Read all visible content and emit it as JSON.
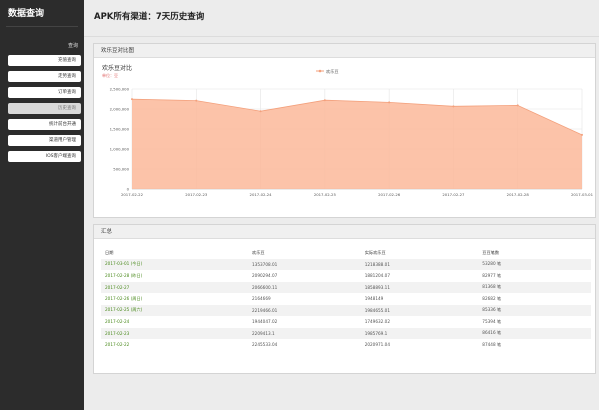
{
  "app": {
    "brand": "数据查询"
  },
  "sidebar": {
    "section_label": "查询",
    "items": [
      {
        "label": "充值查询",
        "active": false
      },
      {
        "label": "走势查询",
        "active": false
      },
      {
        "label": "订单查询",
        "active": false
      },
      {
        "label": "历史查询",
        "active": true
      },
      {
        "label": "统计前台开通",
        "active": false
      },
      {
        "label": "渠道用户管理",
        "active": false
      },
      {
        "label": "IOS客户端查询",
        "active": false
      }
    ]
  },
  "page": {
    "title": "APK所有渠道：7天历史查询"
  },
  "chart_panel": {
    "heading": "欢乐豆对比图"
  },
  "chart_data": {
    "type": "area",
    "title": "欢乐豆对比",
    "subtitle": "单位：豆",
    "x": [
      "2017-02-22",
      "2017-02-23",
      "2017-02-24",
      "2017-02-25",
      "2017-02-26",
      "2017-02-27",
      "2017-02-28",
      "2017-03-01"
    ],
    "series": [
      {
        "name": "欢乐豆",
        "values": [
          2245533.04,
          2209413.1,
          1944047.02,
          2219466.01,
          2164669,
          2066600.11,
          2090294.07,
          1353708.01
        ]
      }
    ],
    "ylim": [
      0,
      2500000
    ],
    "yticks": [
      "0",
      "500,000",
      "1,000,000",
      "1,500,000",
      "2,000,000",
      "2,500,000"
    ],
    "legend_position": "top-right",
    "grid": true,
    "colors": {
      "fill": "#fbb89a",
      "line": "#f3a07c"
    }
  },
  "summary": {
    "heading": "汇总",
    "headers": [
      "日期",
      "欢乐豆",
      "实际欢乐豆",
      "豆豆笔数"
    ],
    "rows": [
      [
        "2017-03-01 (今日)",
        "1353708.01",
        "1218388.01",
        "53280 笔"
      ],
      [
        "2017-02-28 (昨日)",
        "2090294.07",
        "1881204.07",
        "82977 笔"
      ],
      [
        "2017-02-27",
        "2066600.11",
        "1858893.11",
        "81368 笔"
      ],
      [
        "2017-02-26 (周日)",
        "2164669",
        "1948149",
        "82682 笔"
      ],
      [
        "2017-02-25 (周六)",
        "2219466.01",
        "1984655.01",
        "85336 笔"
      ],
      [
        "2017-02-24",
        "1944047.02",
        "1749632.02",
        "75394 笔"
      ],
      [
        "2017-02-23",
        "2209413.1",
        "1985769.1",
        "86416 笔"
      ],
      [
        "2017-02-22",
        "2245533.04",
        "2020971.04",
        "87448 笔"
      ]
    ]
  }
}
